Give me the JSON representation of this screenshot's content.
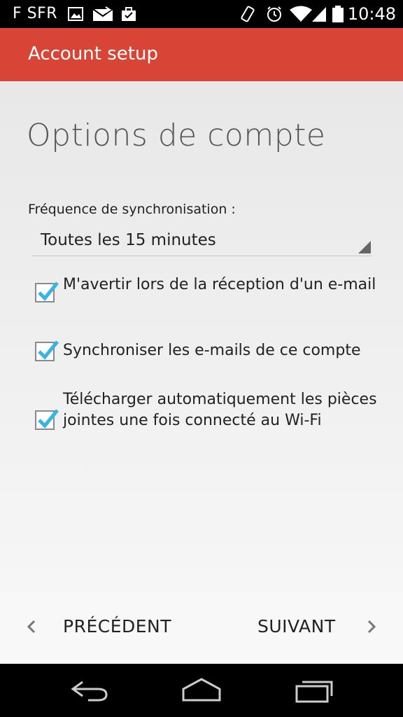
{
  "status_bar": {
    "carrier": "F SFR",
    "time": "10:48",
    "icons": [
      "image-icon",
      "mail-icon",
      "briefcase-icon",
      "vibrate-icon",
      "alarm-icon",
      "wifi-icon",
      "signal-icon",
      "battery-icon"
    ]
  },
  "action_bar": {
    "title": "Account setup"
  },
  "page": {
    "title": "Options de compte"
  },
  "sync": {
    "label": "Fréquence de synchronisation :",
    "selected": "Toutes les 15 minutes"
  },
  "options": [
    {
      "label": "M'avertir lors de la réception d'un e-mail",
      "checked": true
    },
    {
      "label": "Synchroniser les e-mails de ce compte",
      "checked": true
    },
    {
      "label": "Télécharger automatiquement les pièces jointes une fois connecté au Wi-Fi",
      "checked": true
    }
  ],
  "buttons": {
    "previous": "PRÉCÉDENT",
    "next": "SUIVANT"
  },
  "nav": {
    "icons": [
      "back-icon",
      "home-icon",
      "recents-icon"
    ]
  },
  "colors": {
    "accent": "#d84536",
    "checkmark": "#33b5e5"
  }
}
